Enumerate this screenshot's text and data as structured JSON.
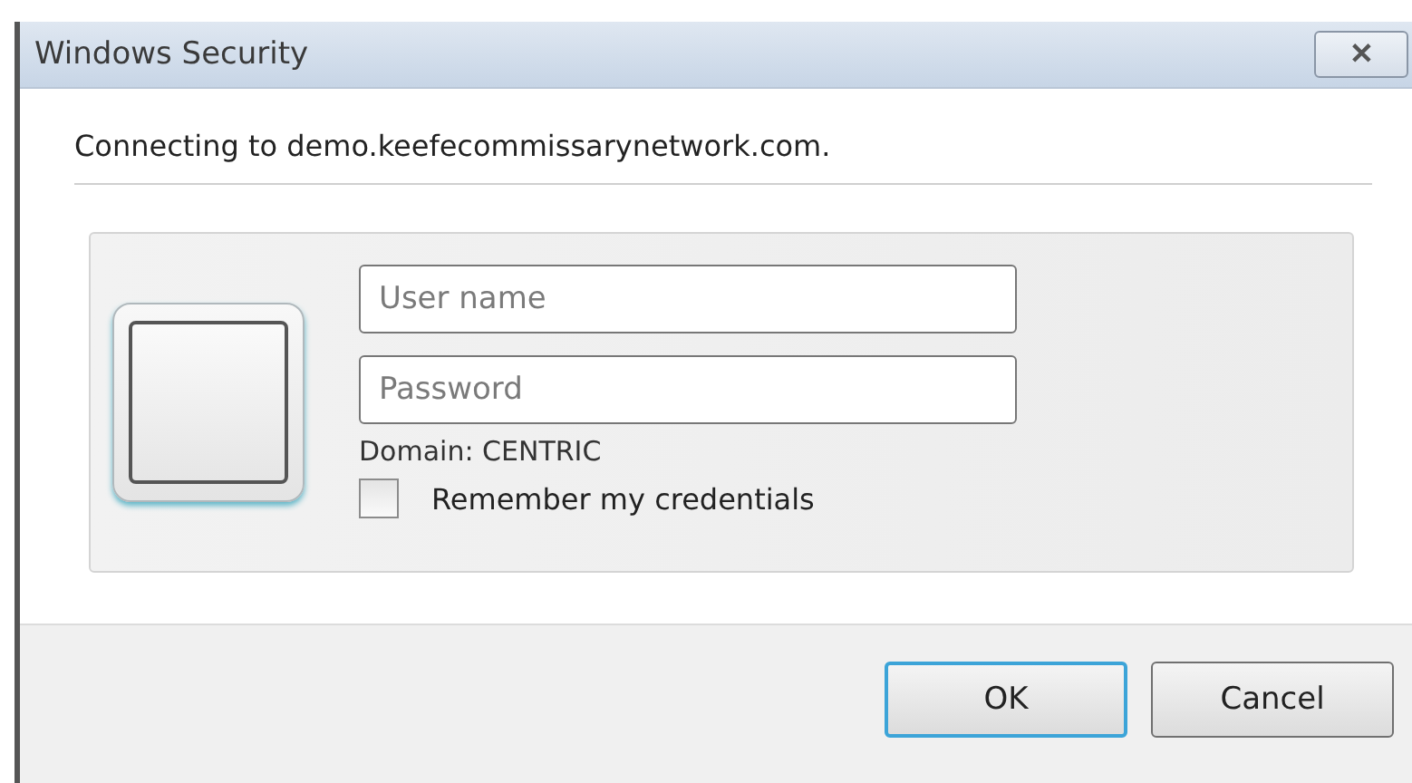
{
  "window": {
    "title": "Windows Security",
    "close": "✕"
  },
  "message": "Connecting to demo.keefecommissarynetwork.com.",
  "credentials": {
    "username": {
      "placeholder": "User name"
    },
    "password": {
      "placeholder": "Password"
    },
    "domain": "Domain: CENTRIC",
    "remember": {
      "label": "Remember my credentials",
      "checked": false
    }
  },
  "buttons": [
    {
      "label": "OK",
      "default": true
    },
    {
      "label": "Cancel",
      "default": false
    }
  ]
}
